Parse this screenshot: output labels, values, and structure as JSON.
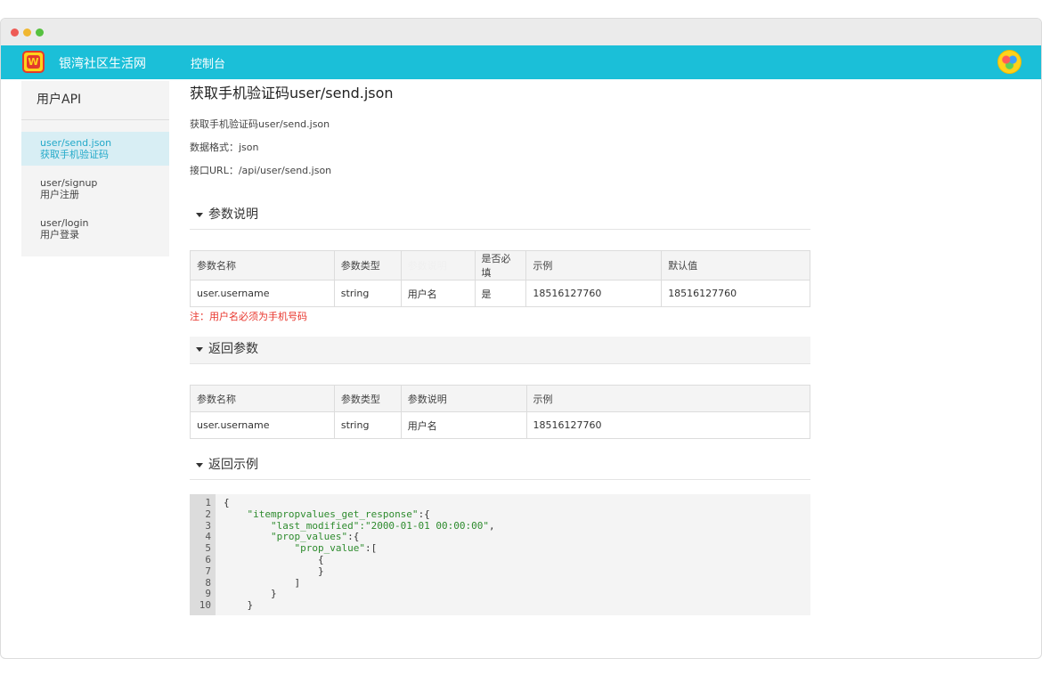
{
  "app": {
    "site_name": "银湾社区生活网",
    "logo_text": "W",
    "nav_console": "控制台"
  },
  "sidebar": {
    "title": "用户API",
    "items": [
      {
        "en": "user/send.json",
        "cn": "获取手机验证码",
        "active": true
      },
      {
        "en": "user/signup",
        "cn": "用户注册",
        "active": false
      },
      {
        "en": "user/login",
        "cn": "用户登录",
        "active": false
      }
    ]
  },
  "main": {
    "title": "获取手机验证码user/send.json",
    "desc": "获取手机验证码user/send.json",
    "format": "数据格式：json",
    "url": "接口URL：/api/user/send.json",
    "params_section": "参数说明",
    "params_table": {
      "headers": [
        "参数名称",
        "参数类型",
        "参数说明",
        "是否必填",
        "示例",
        "默认值"
      ],
      "rows": [
        [
          "user.username",
          "string",
          "用户名",
          "是",
          "18516127760",
          "18516127760"
        ]
      ]
    },
    "note": "注：用户名必须为手机号码",
    "return_section": "返回参数",
    "return_table": {
      "headers": [
        "参数名称",
        "参数类型",
        "参数说明",
        "示例"
      ],
      "rows": [
        [
          "user.username",
          "string",
          "用户名",
          "18516127760"
        ]
      ]
    },
    "example_section": "返回示例",
    "code": {
      "line_numbers": [
        "1",
        "2",
        "3",
        "4",
        "5",
        "6",
        "7",
        "8",
        "9",
        "10"
      ],
      "lines": [
        {
          "pre": "{",
          "str": "",
          "post": ""
        },
        {
          "pre": "    ",
          "str": "\"itempropvalues_get_response\"",
          "post": ":{"
        },
        {
          "pre": "        ",
          "str": "\"last_modified\":\"2000-01-01 00:00:00\"",
          "post": ","
        },
        {
          "pre": "        ",
          "str": "\"prop_values\"",
          "post": ":{"
        },
        {
          "pre": "            ",
          "str": "\"prop_value\"",
          "post": ":["
        },
        {
          "pre": "                {",
          "str": "",
          "post": ""
        },
        {
          "pre": "                }",
          "str": "",
          "post": ""
        },
        {
          "pre": "            ]",
          "str": "",
          "post": ""
        },
        {
          "pre": "        }",
          "str": "",
          "post": ""
        },
        {
          "pre": "    }",
          "str": "",
          "post": ""
        }
      ]
    }
  }
}
